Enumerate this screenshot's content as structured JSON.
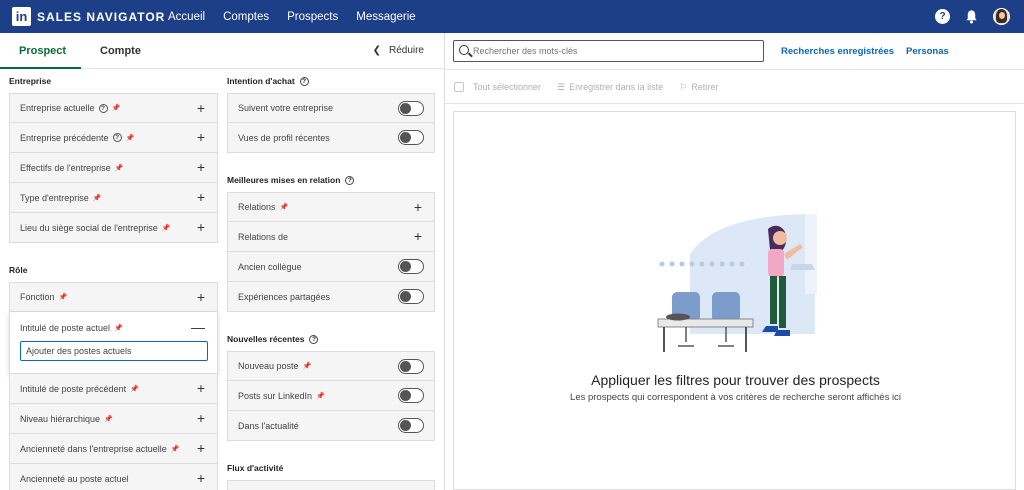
{
  "brand": {
    "logo_letters": "in",
    "name": "SALES NAVIGATOR"
  },
  "nav": [
    "Accueil",
    "Comptes",
    "Prospects",
    "Messagerie"
  ],
  "top_icons": {
    "help": "?"
  },
  "left": {
    "tabs": {
      "prospect": "Prospect",
      "compte": "Compte"
    },
    "collapse_label": "Réduire",
    "entreprise": {
      "title": "Entreprise",
      "items": [
        "Entreprise actuelle",
        "Entreprise précédente",
        "Effectifs de l'entreprise",
        "Type d'entreprise",
        "Lieu du siège social de l'entreprise"
      ]
    },
    "role": {
      "title": "Rôle",
      "items_top": [
        "Fonction"
      ],
      "expanded": {
        "label": "Intitulé de poste actuel",
        "placeholder": "Ajouter des postes actuels"
      },
      "items_bottom": [
        "Intitulé de poste précédent",
        "Niveau hiérarchique",
        "Ancienneté dans l'entreprise actuelle",
        "Ancienneté au poste actuel"
      ]
    },
    "intention": {
      "title": "Intention d'achat",
      "items": [
        "Suivent votre entreprise",
        "Vues de profil récentes"
      ]
    },
    "meilleures": {
      "title": "Meilleures mises en relation",
      "items": [
        "Relations",
        "Relations de",
        "Ancien collègue",
        "Expériences partagées"
      ]
    },
    "nouvelles": {
      "title": "Nouvelles récentes",
      "items": [
        "Nouveau poste",
        "Posts sur LinkedIn",
        "Dans l'actualité"
      ]
    },
    "flux": {
      "title": "Flux d'activité"
    }
  },
  "right": {
    "search_placeholder": "Rechercher des mots-clés",
    "saved_searches": "Recherches enregistrées",
    "personas": "Personas",
    "actions": {
      "select_all": "Tout sélectionner",
      "save_list": "Enregistrer dans la liste",
      "remove": "Retirer"
    },
    "empty_title": "Appliquer les filtres pour trouver des prospects",
    "empty_subtitle": "Les prospects qui correspondent à vos critères de recherche seront affichés ici"
  },
  "colors": {
    "nav_bg": "#1d3f87",
    "accent_green": "#0a6a3a",
    "link_blue": "#0a66c2"
  }
}
